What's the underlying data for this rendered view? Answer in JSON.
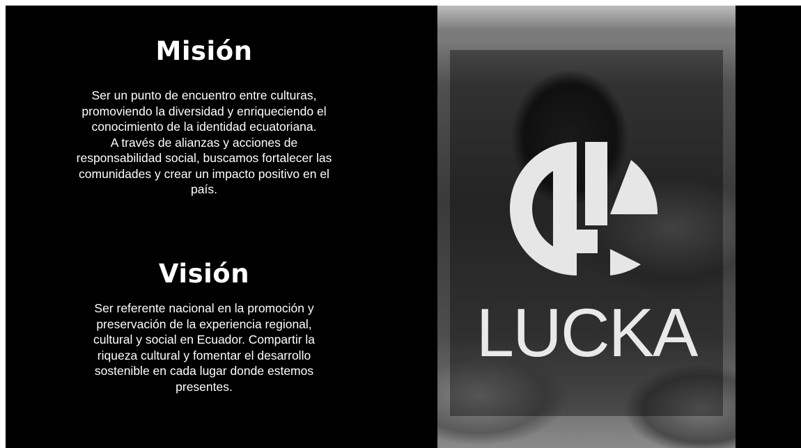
{
  "mission": {
    "title": "Misión",
    "lines": [
      "Ser un punto de encuentro entre culturas,",
      "promoviendo la diversidad y enriqueciendo el",
      "conocimiento de la identidad ecuatoriana.",
      "A través de alianzas y acciones de",
      "responsabilidad social, buscamos fortalecer las",
      "comunidades y crear un impacto positivo en el",
      "país."
    ]
  },
  "vision": {
    "title": "Visión",
    "lines": [
      "Ser referente nacional en la promoción y",
      "preservación de la experiencia regional,",
      "cultural y social en Ecuador. Compartir la",
      "riqueza cultural y fomentar el desarrollo",
      "sostenible en cada lugar donde estemos",
      "presentes."
    ]
  },
  "brand": {
    "name": "LUCKA",
    "logo_icon": "lucka-logo-icon",
    "photo_subject": "clay-pot-and-corn-photo"
  },
  "colors": {
    "background": "#000000",
    "text": "#ffffff",
    "logo": "#e9e9e9"
  }
}
